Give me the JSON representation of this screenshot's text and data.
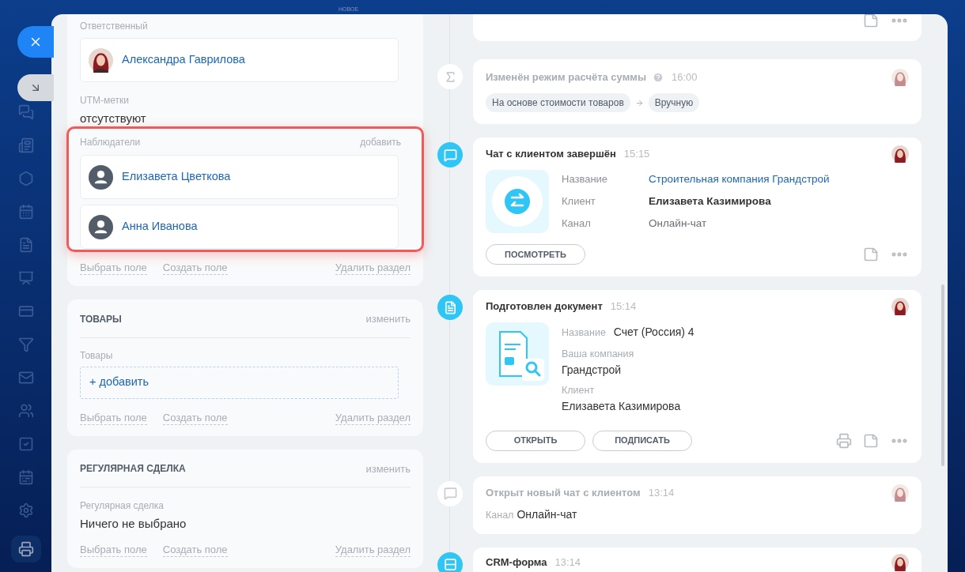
{
  "top_bar": {
    "badge": "НОВОЕ"
  },
  "sections": [
    {
      "fields": [
        {
          "kind": "responsible",
          "label": "Ответственный",
          "users": [
            "Александра Гаврилова"
          ]
        },
        {
          "kind": "text",
          "label": "UTM-метки",
          "value": "отсутствуют"
        },
        {
          "kind": "observers",
          "label": "Наблюдатели",
          "action": "добавить",
          "highlighted": true,
          "users": [
            "Елизавета Цветкова",
            "Анна Иванова"
          ]
        }
      ],
      "footer": {
        "select": "Выбрать поле",
        "create": "Создать поле",
        "delete": "Удалить раздел"
      }
    },
    {
      "title": "ТОВАРЫ",
      "edit": "изменить",
      "fields": [
        {
          "kind": "add",
          "label": "Товары",
          "value": "+ добавить"
        }
      ],
      "footer": {
        "select": "Выбрать поле",
        "create": "Создать поле",
        "delete": "Удалить раздел"
      }
    },
    {
      "title": "РЕГУЛЯРНАЯ СДЕЛКА",
      "edit": "изменить",
      "fields": [
        {
          "kind": "text",
          "label": "Регулярная сделка",
          "value": "Ничего не выбрано"
        }
      ],
      "footer": {
        "select": "Выбрать поле",
        "create": "Создать поле",
        "delete": "Удалить раздел"
      }
    }
  ],
  "timeline": [
    {
      "kind": "partial"
    },
    {
      "kind": "change",
      "muted": true,
      "title": "Изменён режим расчёта суммы",
      "time": "16:00",
      "from": "На основе стоимости товаров",
      "to": "Вручную"
    },
    {
      "kind": "chat",
      "muted": false,
      "title": "Чат с клиентом завершён",
      "time": "15:15",
      "fields": [
        {
          "label": "Название",
          "value": "Строительная компания Грандстрой"
        },
        {
          "label": "Клиент",
          "value": "Елизавета Казимирова"
        },
        {
          "label": "Канал",
          "value": "Онлайн-чат"
        }
      ],
      "buttons": [
        "ПОСМОТРЕТЬ"
      ]
    },
    {
      "kind": "document",
      "muted": false,
      "title": "Подготовлен документ",
      "time": "15:14",
      "fields": [
        {
          "label": "Название",
          "value": "Счет (Россия) 4"
        },
        {
          "label": "Ваша компания",
          "value": "Грандстрой"
        },
        {
          "label": "Клиент",
          "value": "Елизавета Казимирова"
        }
      ],
      "buttons": [
        "ОТКРЫТЬ",
        "ПОДПИСАТЬ"
      ]
    },
    {
      "kind": "info",
      "muted": true,
      "title": "Открыт новый чат с клиентом",
      "time": "13:14",
      "label": "Канал",
      "value": "Онлайн-чат"
    },
    {
      "kind": "form",
      "muted": false,
      "title": "CRM-форма",
      "time": "13:14"
    }
  ]
}
